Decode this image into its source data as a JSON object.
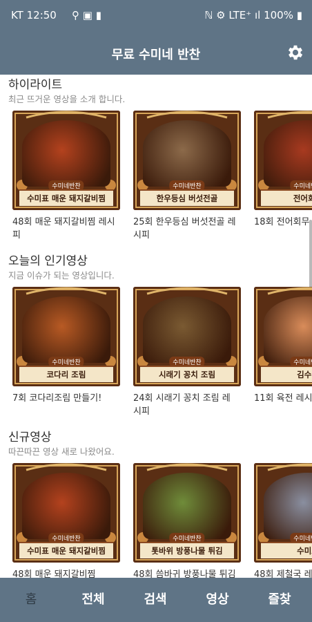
{
  "status": {
    "carrier_time": "KT 12:50",
    "indicators": "⚲ ▣ ▮",
    "network": "ℕ ⚙ LTE⁺ ıl",
    "battery": "100%"
  },
  "appbar": {
    "title": "무료 수미네 반찬"
  },
  "sections": [
    {
      "title": "하이라이트",
      "subtitle": "최근 뜨거운 영상을 소개 합니다.",
      "cards": [
        {
          "caption": "수미표 매운 돼지갈비찜",
          "title": "48회 매운 돼지갈비찜 레시피",
          "color": "#b4421e"
        },
        {
          "caption": "한우등심 버섯전골",
          "title": "25회 한우등심 버섯전골 레시피",
          "color": "#8c6a4a"
        },
        {
          "caption": "전어회무",
          "title": "18회 전어회무",
          "color": "#a83a20"
        }
      ]
    },
    {
      "title": "오늘의 인기영상",
      "subtitle": "지금 이슈가 되는 영상입니다.",
      "cards": [
        {
          "caption": "코다리 조림",
          "title": "7회 코다리조림 만들기!",
          "color": "#b85a24"
        },
        {
          "caption": "시래기 꽁치 조림",
          "title": "24회 시래기 꽁치 조림 레시피",
          "color": "#7a5a32"
        },
        {
          "caption": "김수미",
          "title": "11회 육전 레시",
          "color": "#d98c5a"
        }
      ]
    },
    {
      "title": "신규영상",
      "subtitle": "따끈따끈 영상 새로 나왔어요.",
      "cards": [
        {
          "caption": "수미표 매운 돼지갈비찜",
          "title": "48회 매운 돼지갈비찜",
          "color": "#b4421e"
        },
        {
          "caption": "톳바위 방풍나물 튀김",
          "title": "48회 씀바귀 방풍나물 튀김",
          "color": "#6f8c3a"
        },
        {
          "caption": "수미표",
          "title": "48회 제철국 레",
          "color": "#8a8fa0"
        }
      ]
    }
  ],
  "thumb_logo": "수미네반찬",
  "nav": [
    "홈",
    "전체",
    "검색",
    "영상",
    "즐찾"
  ]
}
